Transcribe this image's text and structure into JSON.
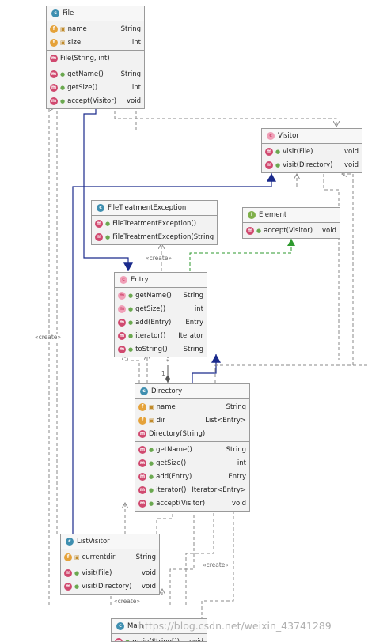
{
  "classes": {
    "file": {
      "name": "File",
      "fields": [
        {
          "name": "name",
          "type": "String"
        },
        {
          "name": "size",
          "type": "int"
        }
      ],
      "constructors": [
        {
          "name": "File(String, int)",
          "type": ""
        }
      ],
      "methods": [
        {
          "name": "getName()",
          "type": "String"
        },
        {
          "name": "getSize()",
          "type": "int"
        },
        {
          "name": "accept(Visitor)",
          "type": "void"
        }
      ]
    },
    "visitor": {
      "name": "Visitor",
      "methods": [
        {
          "name": "visit(File)",
          "type": "void"
        },
        {
          "name": "visit(Directory)",
          "type": "void"
        }
      ]
    },
    "file_treatment_exception": {
      "name": "FileTreatmentException",
      "constructors": [
        {
          "name": "FileTreatmentException()",
          "type": ""
        },
        {
          "name": "FileTreatmentException(String)",
          "type": ""
        }
      ]
    },
    "element": {
      "name": "Element",
      "methods": [
        {
          "name": "accept(Visitor)",
          "type": "void"
        }
      ]
    },
    "entry": {
      "name": "Entry",
      "methods": [
        {
          "name": "getName()",
          "type": "String"
        },
        {
          "name": "getSize()",
          "type": "int"
        },
        {
          "name": "add(Entry)",
          "type": "Entry"
        },
        {
          "name": "iterator()",
          "type": "Iterator"
        },
        {
          "name": "toString()",
          "type": "String"
        }
      ]
    },
    "directory": {
      "name": "Directory",
      "fields": [
        {
          "name": "name",
          "type": "String"
        },
        {
          "name": "dir",
          "type": "List<Entry>"
        }
      ],
      "constructors": [
        {
          "name": "Directory(String)",
          "type": ""
        }
      ],
      "methods": [
        {
          "name": "getName()",
          "type": "String"
        },
        {
          "name": "getSize()",
          "type": "int"
        },
        {
          "name": "add(Entry)",
          "type": "Entry"
        },
        {
          "name": "iterator()",
          "type": "Iterator<Entry>"
        },
        {
          "name": "accept(Visitor)",
          "type": "void"
        }
      ]
    },
    "list_visitor": {
      "name": "ListVisitor",
      "fields": [
        {
          "name": "currentdir",
          "type": "String"
        }
      ],
      "methods": [
        {
          "name": "visit(File)",
          "type": "void"
        },
        {
          "name": "visit(Directory)",
          "type": "void"
        }
      ]
    },
    "main": {
      "name": "Main",
      "methods": [
        {
          "name": "main(String[])",
          "type": "void"
        }
      ]
    }
  },
  "labels": {
    "create_left": "«create»",
    "create_entry": "«create»",
    "create_dir": "«create»",
    "create_bottom": "«create»",
    "multiplicity": "*",
    "multiplicity_one": "1"
  },
  "watermark": "https://blog.csdn.net/weixin_43741289",
  "colors": {
    "realization": "#1a2a8c",
    "dependency": "#8a8a8a",
    "element_realization": "#2e9a2e"
  }
}
